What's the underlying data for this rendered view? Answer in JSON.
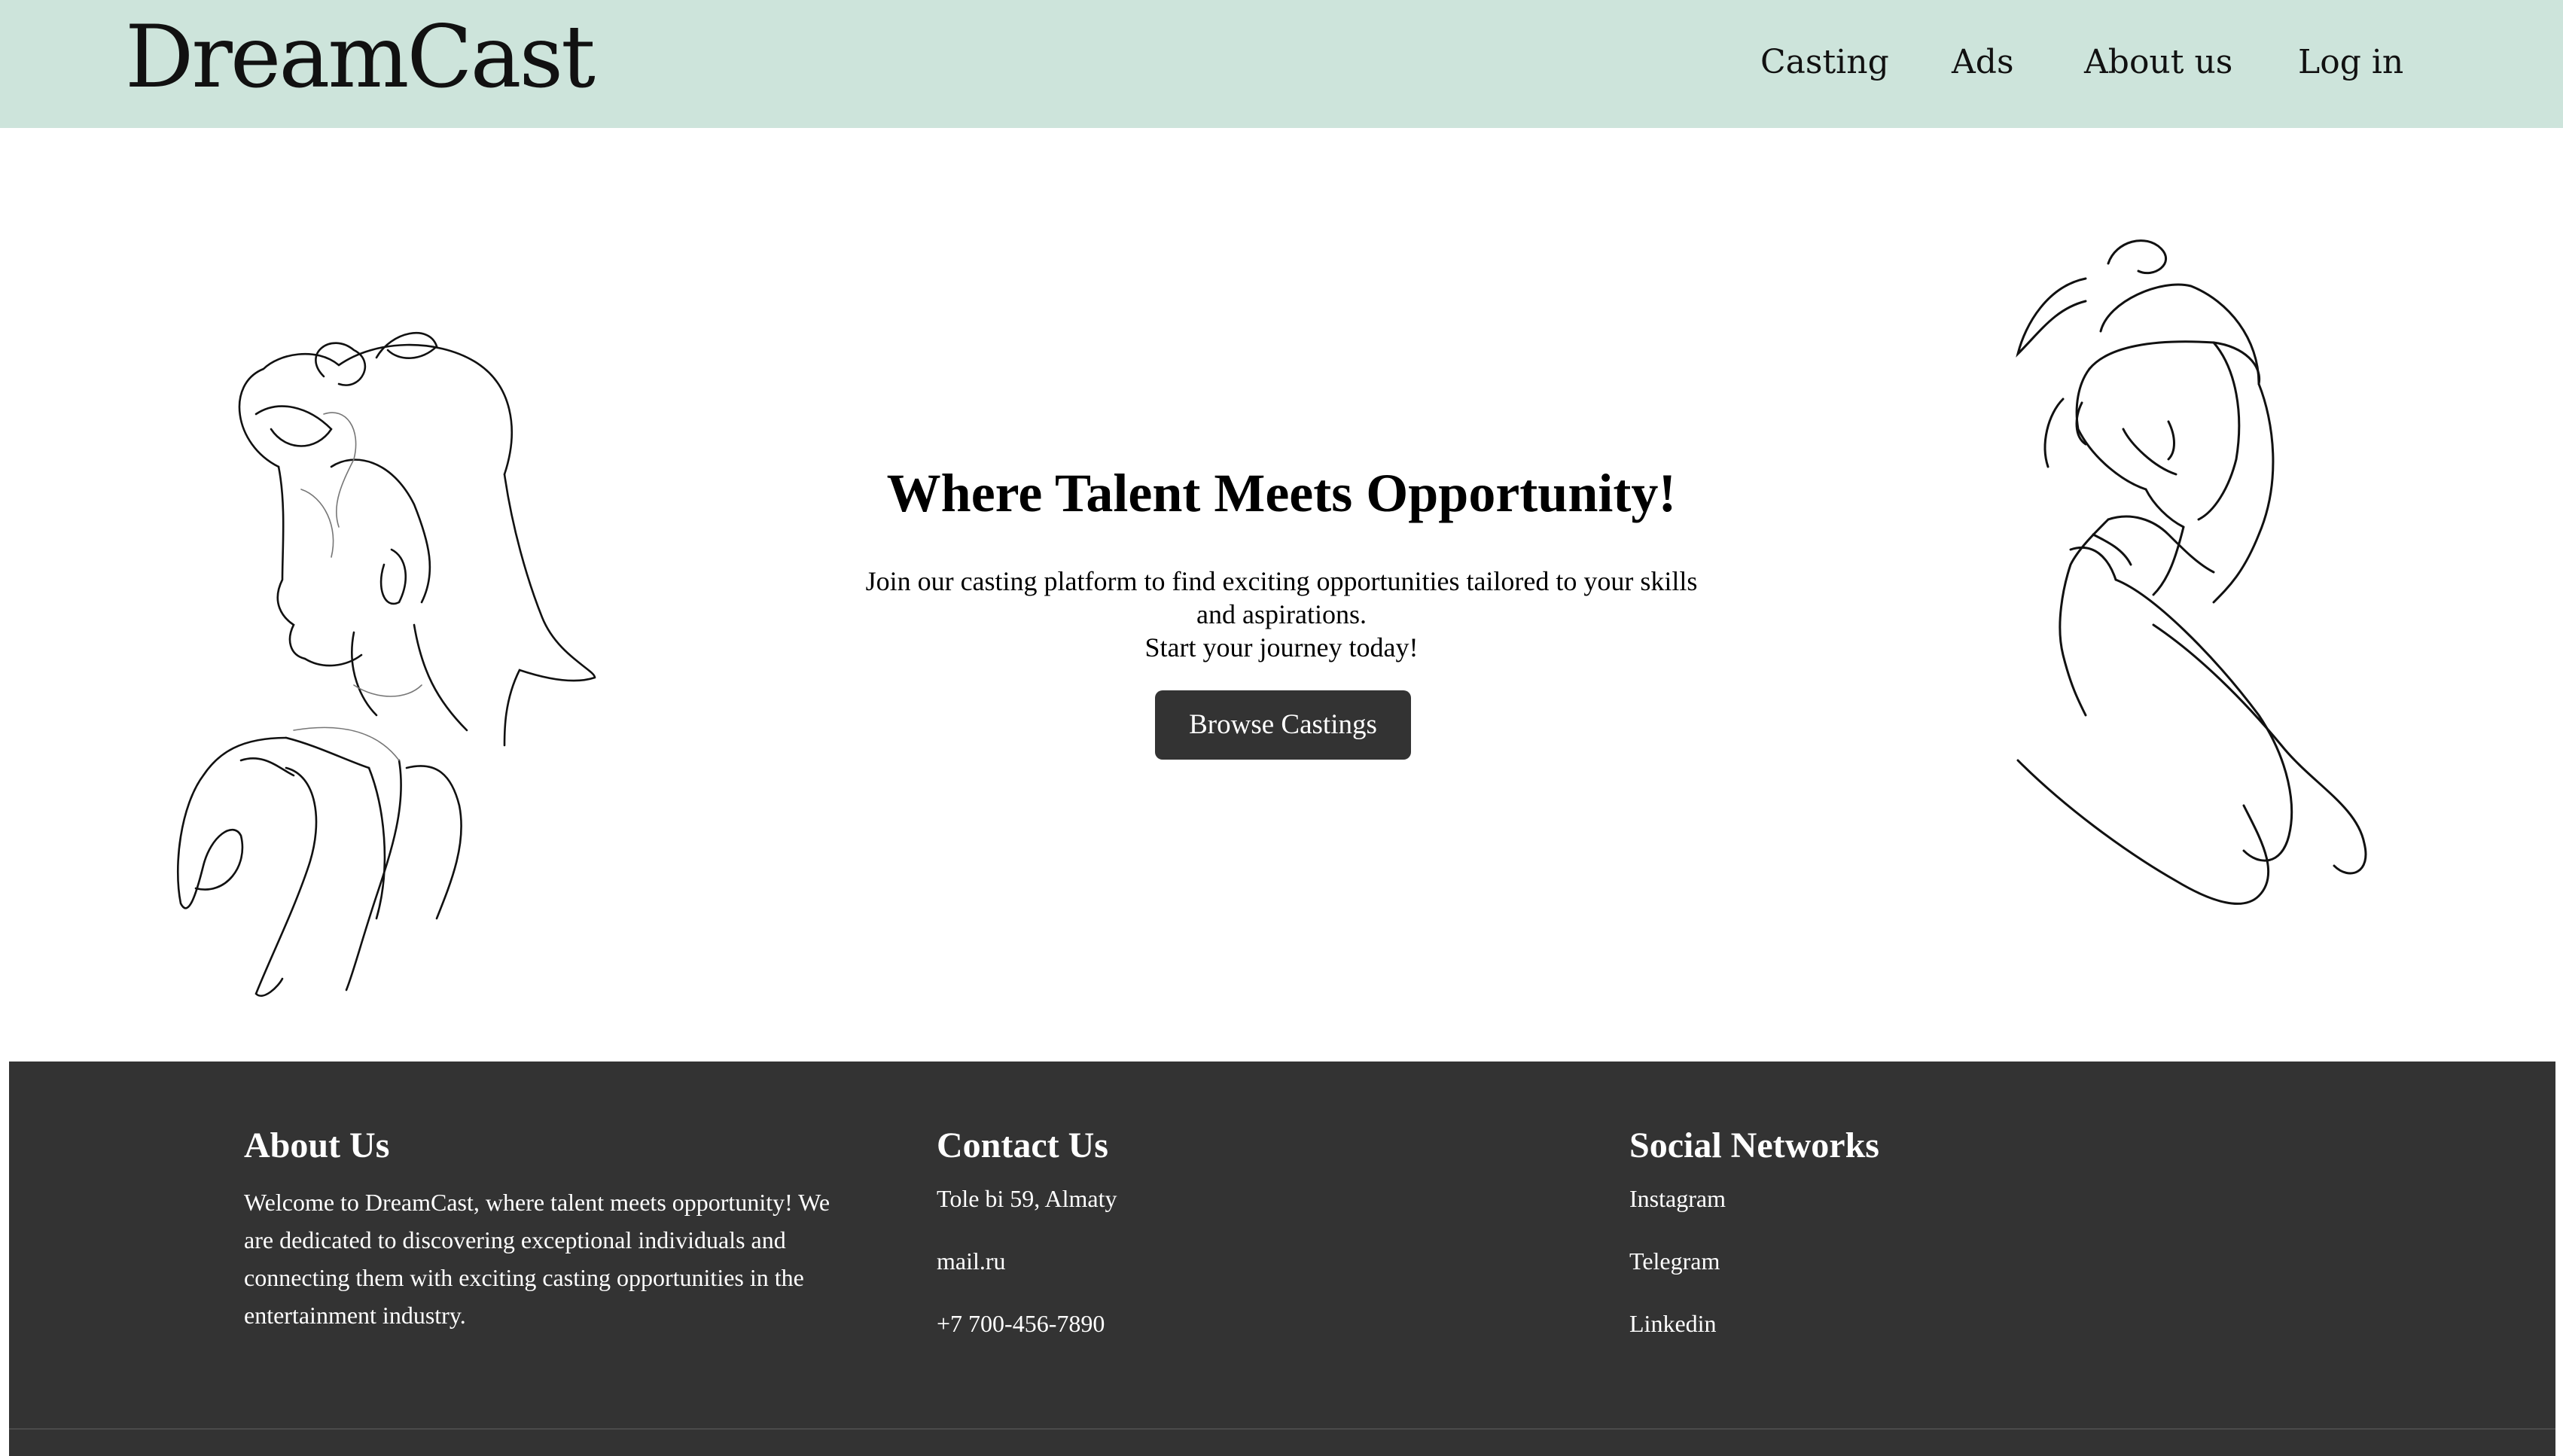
{
  "header": {
    "logo": "DreamCast",
    "nav": [
      "Casting",
      "Ads",
      "About us",
      "Log in"
    ]
  },
  "hero": {
    "title": "Where Talent Meets Opportunity!",
    "text_line1": "Join our casting platform to find exciting opportunities tailored to your skills",
    "text_line2": "and aspirations.",
    "text_line3": "Start your journey today!",
    "button_label": "Browse Castings"
  },
  "footer": {
    "about": {
      "title": "About Us",
      "text": "Welcome to DreamCast, where talent meets opportunity! We are dedicated to discovering exceptional individuals and connecting them with exciting casting opportunities in the entertainment industry."
    },
    "contact": {
      "title": "Contact Us",
      "items": [
        "Tole bi 59, Almaty",
        "mail.ru",
        "+7 700-456-7890"
      ]
    },
    "social": {
      "title": "Social Networks",
      "items": [
        "Instagram",
        "Telegram",
        "Linkedin"
      ]
    }
  },
  "colors": {
    "header_bg": "#cde4db",
    "footer_bg": "#333333",
    "button_bg": "#333333"
  }
}
